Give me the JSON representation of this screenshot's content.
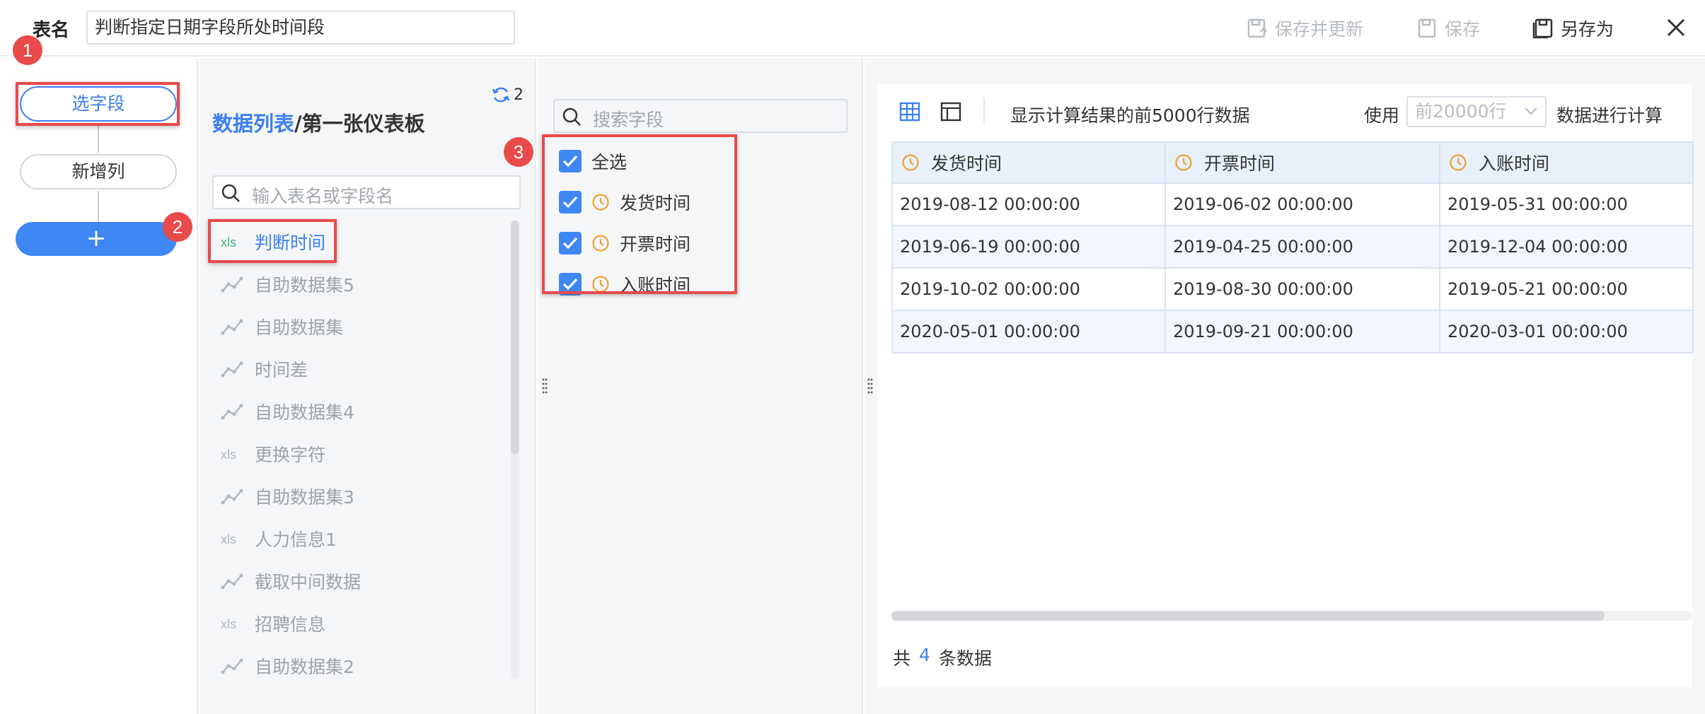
{
  "header": {
    "table_name_label": "表名",
    "table_name_value": "判断指定日期字段所处时间段",
    "save_update_label": "保存并更新",
    "save_label": "保存",
    "save_as_label": "另存为"
  },
  "steps": {
    "items": [
      {
        "label": "选字段",
        "active": true
      },
      {
        "label": "新增列",
        "active": false
      }
    ],
    "add_label": "+"
  },
  "annotations": [
    "1",
    "2",
    "3"
  ],
  "data_list": {
    "refresh_count": "2",
    "breadcrumb_root": "数据列表",
    "breadcrumb_sep": "/",
    "breadcrumb_current": "第一张仪表板",
    "search_placeholder": "输入表名或字段名",
    "items": [
      {
        "label": "判断时间",
        "icon": "excel-icon",
        "current": true
      },
      {
        "label": "自助数据集5",
        "icon": "dataset-icon",
        "current": false
      },
      {
        "label": "自助数据集",
        "icon": "dataset-icon",
        "current": false
      },
      {
        "label": "时间差",
        "icon": "dataset-icon",
        "current": false
      },
      {
        "label": "自助数据集4",
        "icon": "dataset-icon",
        "current": false
      },
      {
        "label": "更换字符",
        "icon": "excel-icon",
        "current": false
      },
      {
        "label": "自助数据集3",
        "icon": "dataset-icon",
        "current": false
      },
      {
        "label": "人力信息1",
        "icon": "excel-icon",
        "current": false
      },
      {
        "label": "截取中间数据",
        "icon": "dataset-icon",
        "current": false
      },
      {
        "label": "招聘信息",
        "icon": "excel-icon",
        "current": false
      },
      {
        "label": "自助数据集2",
        "icon": "dataset-icon",
        "current": false
      }
    ]
  },
  "fields": {
    "search_placeholder": "搜索字段",
    "select_all_label": "全选",
    "items": [
      {
        "label": "发货时间",
        "checked": true
      },
      {
        "label": "开票时间",
        "checked": true
      },
      {
        "label": "入账时间",
        "checked": true
      }
    ]
  },
  "preview": {
    "info_text": "显示计算结果的前5000行数据",
    "use_label": "使用",
    "row_limit_value": "前20000行",
    "calc_label": "数据进行计算",
    "columns": [
      "发货时间",
      "开票时间",
      "入账时间"
    ],
    "rows": [
      [
        "2019-08-12 00:00:00",
        "2019-06-02 00:00:00",
        "2019-05-31 00:00:00"
      ],
      [
        "2019-06-19 00:00:00",
        "2019-04-25 00:00:00",
        "2019-12-04 00:00:00"
      ],
      [
        "2019-10-02 00:00:00",
        "2019-08-30 00:00:00",
        "2019-05-21 00:00:00"
      ],
      [
        "2020-05-01 00:00:00",
        "2019-09-21 00:00:00",
        "2020-03-01 00:00:00"
      ]
    ],
    "count_prefix": "共",
    "count_value": "4",
    "count_suffix": "条数据"
  },
  "colors": {
    "accent": "#3f87f5",
    "annotation_red": "#e94a4a",
    "time_icon_orange": "#f0a030",
    "excel_green": "#3cb371"
  }
}
